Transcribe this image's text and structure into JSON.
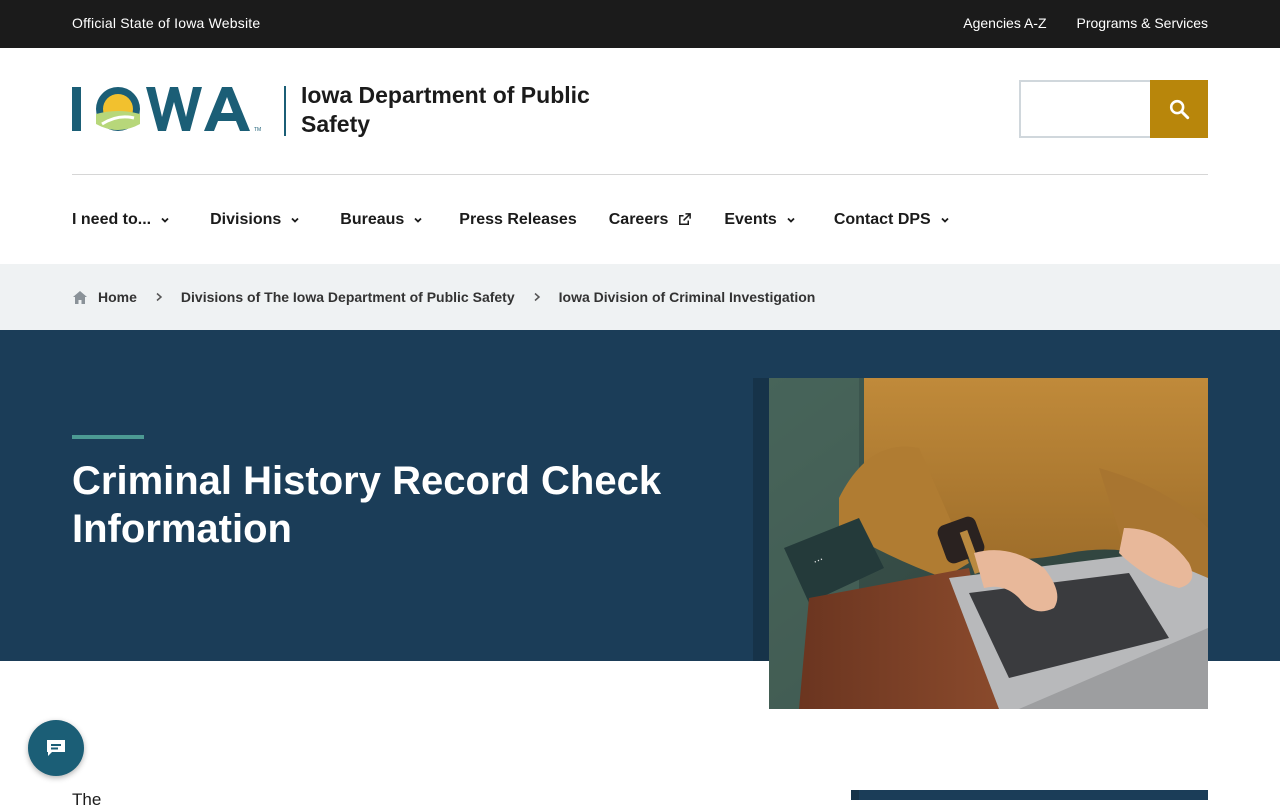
{
  "topbar": {
    "official": "Official State of Iowa Website",
    "links": [
      "Agencies A-Z",
      "Programs & Services"
    ]
  },
  "header": {
    "logo_text": "IOWA",
    "dept_name": "Iowa Department of Public Safety",
    "search_placeholder": ""
  },
  "nav": {
    "items": [
      {
        "label": "I need to...",
        "has_dropdown": true
      },
      {
        "label": "Divisions",
        "has_dropdown": true
      },
      {
        "label": "Bureaus",
        "has_dropdown": true
      },
      {
        "label": "Press Releases",
        "has_dropdown": false
      },
      {
        "label": "Careers",
        "external": true
      },
      {
        "label": "Events",
        "has_dropdown": true
      },
      {
        "label": "Contact DPS",
        "has_dropdown": true
      }
    ]
  },
  "breadcrumb": {
    "items": [
      "Home",
      "Divisions of The Iowa Department of Public Safety",
      "Iowa Division of Criminal Investigation"
    ]
  },
  "hero": {
    "title": "Criminal History Record Check Information"
  },
  "body": {
    "intro": "The"
  },
  "colors": {
    "topbar": "#1b1b1b",
    "hero": "#1b3d58",
    "accent_gold": "#b8860b",
    "accent_teal": "#4c9a93",
    "logo_teal": "#1b5e76"
  }
}
